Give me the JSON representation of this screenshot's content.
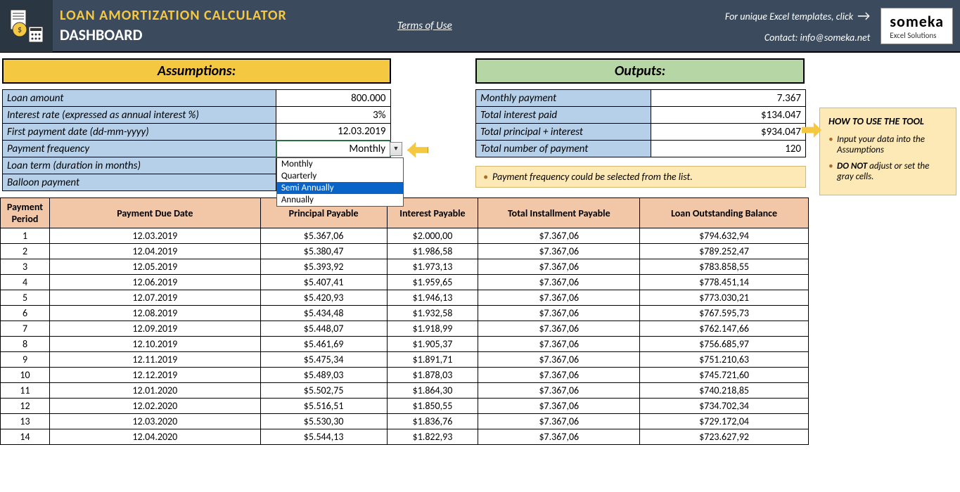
{
  "header": {
    "title": "LOAN AMORTIZATION CALCULATOR",
    "subtitle": "DASHBOARD",
    "terms_link": "Terms of Use",
    "promo_text": "For unique Excel templates, click",
    "contact_text": "Contact: info@someka.net",
    "logo_text": "someka",
    "logo_sub": "Excel Solutions"
  },
  "sections": {
    "assumptions_header": "Assumptions:",
    "outputs_header": "Outputs:"
  },
  "assumptions": {
    "labels": {
      "loan_amount": "Loan amount",
      "interest_rate": "Interest rate (expressed as annual interest %)",
      "first_payment": "First payment date (dd-mm-yyyy)",
      "frequency": "Payment frequency",
      "loan_term": "Loan term (duration in months)",
      "balloon": "Balloon payment"
    },
    "values": {
      "loan_amount": "800.000",
      "interest_rate": "3%",
      "first_payment": "12.03.2019",
      "frequency": "Monthly",
      "loan_term": "",
      "balloon": ""
    }
  },
  "frequency_options": [
    "Monthly",
    "Quarterly",
    "Semi Annually",
    "Annually"
  ],
  "frequency_selected_index": 2,
  "outputs": {
    "labels": {
      "monthly_payment": "Monthly payment",
      "total_interest": "Total interest paid",
      "total_principal_interest": "Total principal + interest",
      "total_payments": "Total number of payment"
    },
    "values": {
      "monthly_payment": "7.367",
      "total_interest": "$134.047",
      "total_principal_interest": "$934.047",
      "total_payments": "120"
    }
  },
  "note": "Payment frequency could be selected from the list.",
  "help": {
    "title": "HOW TO USE THE TOOL",
    "items": [
      "Input your data into the Assumptions",
      "<b>DO NOT</b> adjust or set the gray cells."
    ]
  },
  "amort": {
    "headers": [
      "Payment Period",
      "Payment Due Date",
      "Principal Payable",
      "Interest Payable",
      "Total Installment Payable",
      "Loan Outstanding Balance"
    ],
    "rows": [
      [
        "1",
        "12.03.2019",
        "$5.367,06",
        "$2.000,00",
        "$7.367,06",
        "$794.632,94"
      ],
      [
        "2",
        "12.04.2019",
        "$5.380,47",
        "$1.986,58",
        "$7.367,06",
        "$789.252,47"
      ],
      [
        "3",
        "12.05.2019",
        "$5.393,92",
        "$1.973,13",
        "$7.367,06",
        "$783.858,55"
      ],
      [
        "4",
        "12.06.2019",
        "$5.407,41",
        "$1.959,65",
        "$7.367,06",
        "$778.451,14"
      ],
      [
        "5",
        "12.07.2019",
        "$5.420,93",
        "$1.946,13",
        "$7.367,06",
        "$773.030,21"
      ],
      [
        "6",
        "12.08.2019",
        "$5.434,48",
        "$1.932,58",
        "$7.367,06",
        "$767.595,73"
      ],
      [
        "7",
        "12.09.2019",
        "$5.448,07",
        "$1.918,99",
        "$7.367,06",
        "$762.147,66"
      ],
      [
        "8",
        "12.10.2019",
        "$5.461,69",
        "$1.905,37",
        "$7.367,06",
        "$756.685,97"
      ],
      [
        "9",
        "12.11.2019",
        "$5.475,34",
        "$1.891,71",
        "$7.367,06",
        "$751.210,63"
      ],
      [
        "10",
        "12.12.2019",
        "$5.489,03",
        "$1.878,03",
        "$7.367,06",
        "$745.721,60"
      ],
      [
        "11",
        "12.01.2020",
        "$5.502,75",
        "$1.864,30",
        "$7.367,06",
        "$740.218,85"
      ],
      [
        "12",
        "12.02.2020",
        "$5.516,51",
        "$1.850,55",
        "$7.367,06",
        "$734.702,34"
      ],
      [
        "13",
        "12.03.2020",
        "$5.530,30",
        "$1.836,76",
        "$7.367,06",
        "$729.172,04"
      ],
      [
        "14",
        "12.04.2020",
        "$5.544,13",
        "$1.822,93",
        "$7.367,06",
        "$723.627,92"
      ]
    ]
  }
}
